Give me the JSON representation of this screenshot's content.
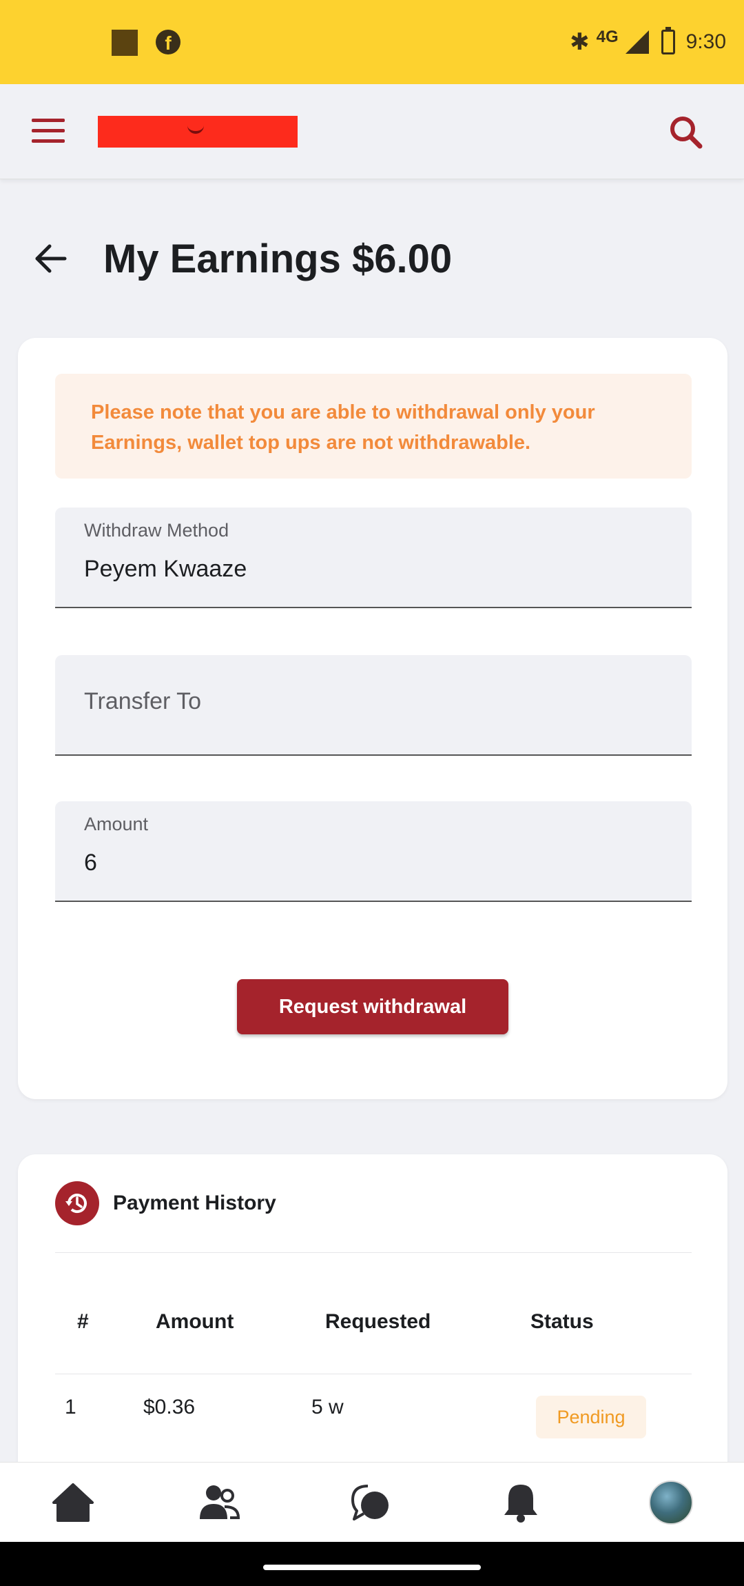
{
  "status_bar": {
    "network": "4G",
    "time": "9:30"
  },
  "app_bar": {
    "menu_icon": "hamburger-icon",
    "search_icon": "search-icon",
    "brand_color": "#a5232c"
  },
  "page": {
    "title": "My Earnings $6.00"
  },
  "notice": {
    "text": "Please note that you are able to withdrawal only your Earnings, wallet top ups are not withdrawable."
  },
  "form": {
    "withdraw_method": {
      "label": "Withdraw Method",
      "value": "Peyem Kwaaze"
    },
    "transfer_to": {
      "placeholder": "Transfer To",
      "value": ""
    },
    "amount": {
      "label": "Amount",
      "value": "6"
    },
    "submit_label": "Request withdrawal"
  },
  "history": {
    "title": "Payment History",
    "icon": "history-icon",
    "columns": [
      "#",
      "Amount",
      "Requested",
      "Status"
    ],
    "rows": [
      {
        "index": "1",
        "amount": "$0.36",
        "requested": "5 w",
        "status": "Pending"
      }
    ]
  },
  "bottom_nav": {
    "items": [
      "home-icon",
      "friends-icon",
      "messages-icon",
      "notifications-icon",
      "profile-avatar"
    ]
  },
  "colors": {
    "status_bar": "#fdd22f",
    "accent": "#a5232c",
    "notice_text": "#f28a3b",
    "pending": "#f09a22"
  }
}
